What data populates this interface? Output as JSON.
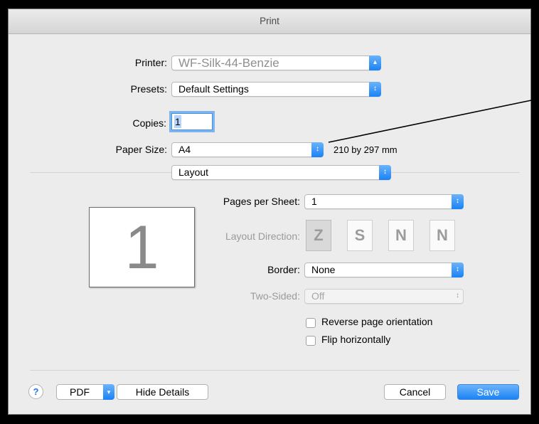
{
  "window": {
    "title": "Print"
  },
  "printer": {
    "label": "Printer:",
    "value": "WF-Silk-44-Benzie"
  },
  "presets": {
    "label": "Presets:",
    "value": "Default Settings"
  },
  "copies": {
    "label": "Copies:",
    "value": "1"
  },
  "paper_size": {
    "label": "Paper Size:",
    "value": "A4",
    "dimensions": "210 by 297 mm"
  },
  "section": {
    "value": "Layout"
  },
  "preview": {
    "page_number": "1"
  },
  "layout": {
    "pages_per_sheet": {
      "label": "Pages per Sheet:",
      "value": "1"
    },
    "layout_direction": {
      "label": "Layout Direction:",
      "options": [
        "Z",
        "S",
        "N",
        "N"
      ]
    },
    "border": {
      "label": "Border:",
      "value": "None"
    },
    "two_sided": {
      "label": "Two-Sided:",
      "value": "Off"
    },
    "reverse_orientation": {
      "label": "Reverse page orientation",
      "checked": false
    },
    "flip_horizontally": {
      "label": "Flip horizontally",
      "checked": false
    }
  },
  "footer": {
    "help_label": "?",
    "pdf_label": "PDF",
    "hide_details_label": "Hide Details",
    "cancel_label": "Cancel",
    "save_label": "Save"
  },
  "colors": {
    "accent": "#1a82f6",
    "dialog_bg": "#ececec"
  },
  "icons": {
    "popup_arrow": "updown-chevron-icon",
    "pdf_menu": "chevron-down-icon"
  }
}
